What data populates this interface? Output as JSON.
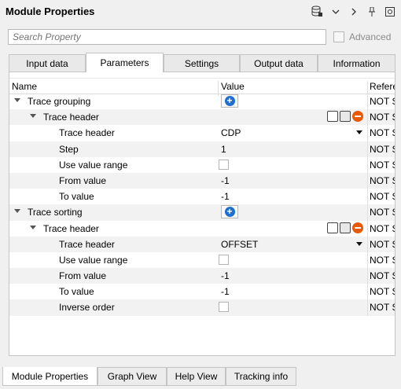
{
  "window": {
    "title": "Module Properties",
    "icons": [
      "database-icon",
      "chevron-down-icon",
      "chevron-right-icon",
      "pin-icon",
      "window-icon"
    ]
  },
  "search": {
    "placeholder": "Search Property",
    "value": ""
  },
  "advanced": {
    "label": "Advanced",
    "checked": false
  },
  "tabs": [
    {
      "label": "Input data"
    },
    {
      "label": "Parameters",
      "active": true
    },
    {
      "label": "Settings"
    },
    {
      "label": "Output data"
    },
    {
      "label": "Information"
    }
  ],
  "columns": {
    "name": "Name",
    "value": "Value",
    "ref": "Refere"
  },
  "rows": [
    {
      "name": "Trace grouping",
      "ref": "NOT S"
    },
    {
      "name": "Trace header",
      "ref": "NOT S"
    },
    {
      "name": "Trace header",
      "value": "CDP",
      "ref": "NOT S"
    },
    {
      "name": "Step",
      "value": "1",
      "ref": "NOT S"
    },
    {
      "name": "Use value range",
      "ref": "NOT S"
    },
    {
      "name": "From value",
      "value": "-1",
      "ref": "NOT S"
    },
    {
      "name": "To value",
      "value": "-1",
      "ref": "NOT S"
    },
    {
      "name": "Trace sorting",
      "ref": "NOT S"
    },
    {
      "name": "Trace header",
      "ref": "NOT S"
    },
    {
      "name": "Trace header",
      "value": "OFFSET",
      "ref": "NOT S"
    },
    {
      "name": "Use value range",
      "ref": "NOT S"
    },
    {
      "name": "From value",
      "value": "-1",
      "ref": "NOT S"
    },
    {
      "name": "To value",
      "value": "-1",
      "ref": "NOT S"
    },
    {
      "name": "Inverse order",
      "ref": "NOT S"
    }
  ],
  "bottom_tabs": [
    {
      "label": "Module Properties",
      "active": true
    },
    {
      "label": "Graph View"
    },
    {
      "label": "Help View"
    },
    {
      "label": "Tracking info"
    }
  ],
  "colors": {
    "accent": "#1e6fd0",
    "remove": "#e8590c",
    "alt_row": "#f2f2f2"
  }
}
